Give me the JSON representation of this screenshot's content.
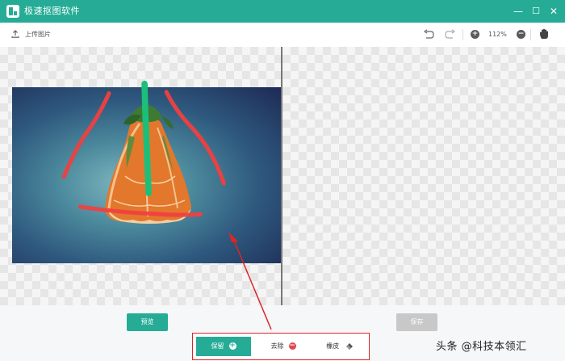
{
  "app": {
    "title": "极速抠图软件"
  },
  "window_controls": {
    "minimize": "—",
    "maximize": "☐",
    "close": "✕"
  },
  "toolbar": {
    "upload_label": "上传图片",
    "zoom": "112%"
  },
  "buttons": {
    "preview": "预览",
    "save": "保存"
  },
  "modes": {
    "keep": "保留",
    "remove": "去除",
    "eraser": "橡皮"
  },
  "watermark": "头条 @科技本领汇",
  "colors": {
    "brand": "#26ac96",
    "keep_stroke": "#1bbf7a",
    "remove_stroke": "#f04040",
    "highlight": "#e02424",
    "save_disabled": "#c8c8c8"
  }
}
